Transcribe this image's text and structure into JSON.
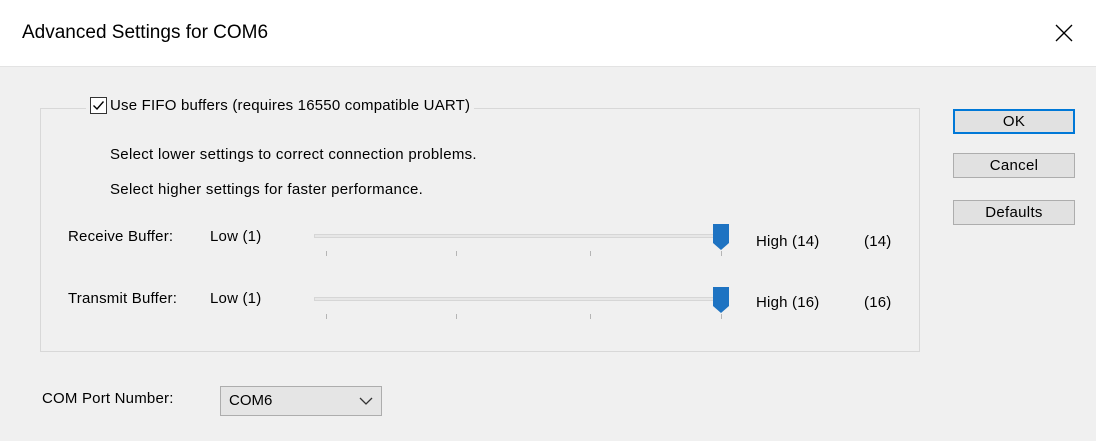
{
  "window": {
    "title": "Advanced Settings for COM6"
  },
  "fifo": {
    "checkbox_label": "Use FIFO buffers (requires 16550 compatible UART)",
    "checked": true,
    "info_lower": "Select lower settings to correct connection problems.",
    "info_higher": "Select higher settings for faster performance."
  },
  "receive": {
    "label": "Receive Buffer:",
    "low": "Low (1)",
    "high": "High (14)",
    "current": "(14)",
    "value": 14,
    "min": 1,
    "max": 14
  },
  "transmit": {
    "label": "Transmit Buffer:",
    "low": "Low (1)",
    "high": "High (16)",
    "current": "(16)",
    "value": 16,
    "min": 1,
    "max": 16
  },
  "buttons": {
    "ok": "OK",
    "cancel": "Cancel",
    "defaults": "Defaults"
  },
  "com_port": {
    "label": "COM Port Number:",
    "selected": "COM6"
  },
  "colors": {
    "accent": "#0078d7",
    "thumb": "#1e73c2"
  }
}
